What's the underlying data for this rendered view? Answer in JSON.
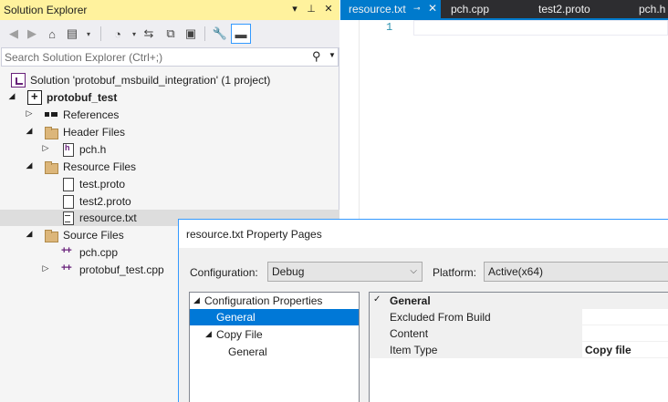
{
  "solution_explorer": {
    "title": "Solution Explorer",
    "title_controls": {
      "dropdown": "▾",
      "pin": "⊥",
      "close": "✕"
    },
    "search": {
      "placeholder": "Search Solution Explorer (Ctrl+;)"
    },
    "tree": [
      {
        "label": "Solution 'protobuf_msbuild_integration' (1 project)",
        "icon": "solution-icon",
        "expander": ""
      },
      {
        "label": "protobuf_test",
        "icon": "project-icon",
        "expander": "◢",
        "bold": true
      },
      {
        "label": "References",
        "icon": "references-icon",
        "expander": "▷"
      },
      {
        "label": "Header Files",
        "icon": "folder-icon",
        "expander": "◢"
      },
      {
        "label": "pch.h",
        "icon": "header-file-icon",
        "expander": "▷"
      },
      {
        "label": "Resource Files",
        "icon": "folder-icon",
        "expander": "◢"
      },
      {
        "label": "test.proto",
        "icon": "file-icon",
        "expander": ""
      },
      {
        "label": "test2.proto",
        "icon": "file-icon",
        "expander": ""
      },
      {
        "label": "resource.txt",
        "icon": "text-file-icon",
        "expander": "",
        "selected": true
      },
      {
        "label": "Source Files",
        "icon": "folder-icon",
        "expander": "◢"
      },
      {
        "label": "pch.cpp",
        "icon": "cpp-file-icon",
        "expander": ""
      },
      {
        "label": "protobuf_test.cpp",
        "icon": "cpp-file-icon",
        "expander": "▷"
      }
    ]
  },
  "editor": {
    "tabs": [
      {
        "label": "resource.txt",
        "active": true,
        "pin": "⊸",
        "close": "✕"
      },
      {
        "label": "pch.cpp",
        "active": false
      },
      {
        "label": "test2.proto",
        "active": false
      },
      {
        "label": "pch.h",
        "active": false
      }
    ],
    "line_number": "1"
  },
  "dialog": {
    "title": "resource.txt Property Pages",
    "configuration_label": "Configuration:",
    "configuration_value": "Debug",
    "platform_label": "Platform:",
    "platform_value": "Active(x64)",
    "config_tree": [
      {
        "label": "Configuration Properties",
        "expander": "◢"
      },
      {
        "label": "General",
        "expander": "",
        "selected": true
      },
      {
        "label": "Copy File",
        "expander": "◢"
      },
      {
        "label": "General",
        "expander": ""
      }
    ],
    "property_grid": {
      "category": "General",
      "rows": [
        {
          "name": "Excluded From Build",
          "value": ""
        },
        {
          "name": "Content",
          "value": ""
        },
        {
          "name": "Item Type",
          "value": "Copy file"
        }
      ]
    }
  }
}
